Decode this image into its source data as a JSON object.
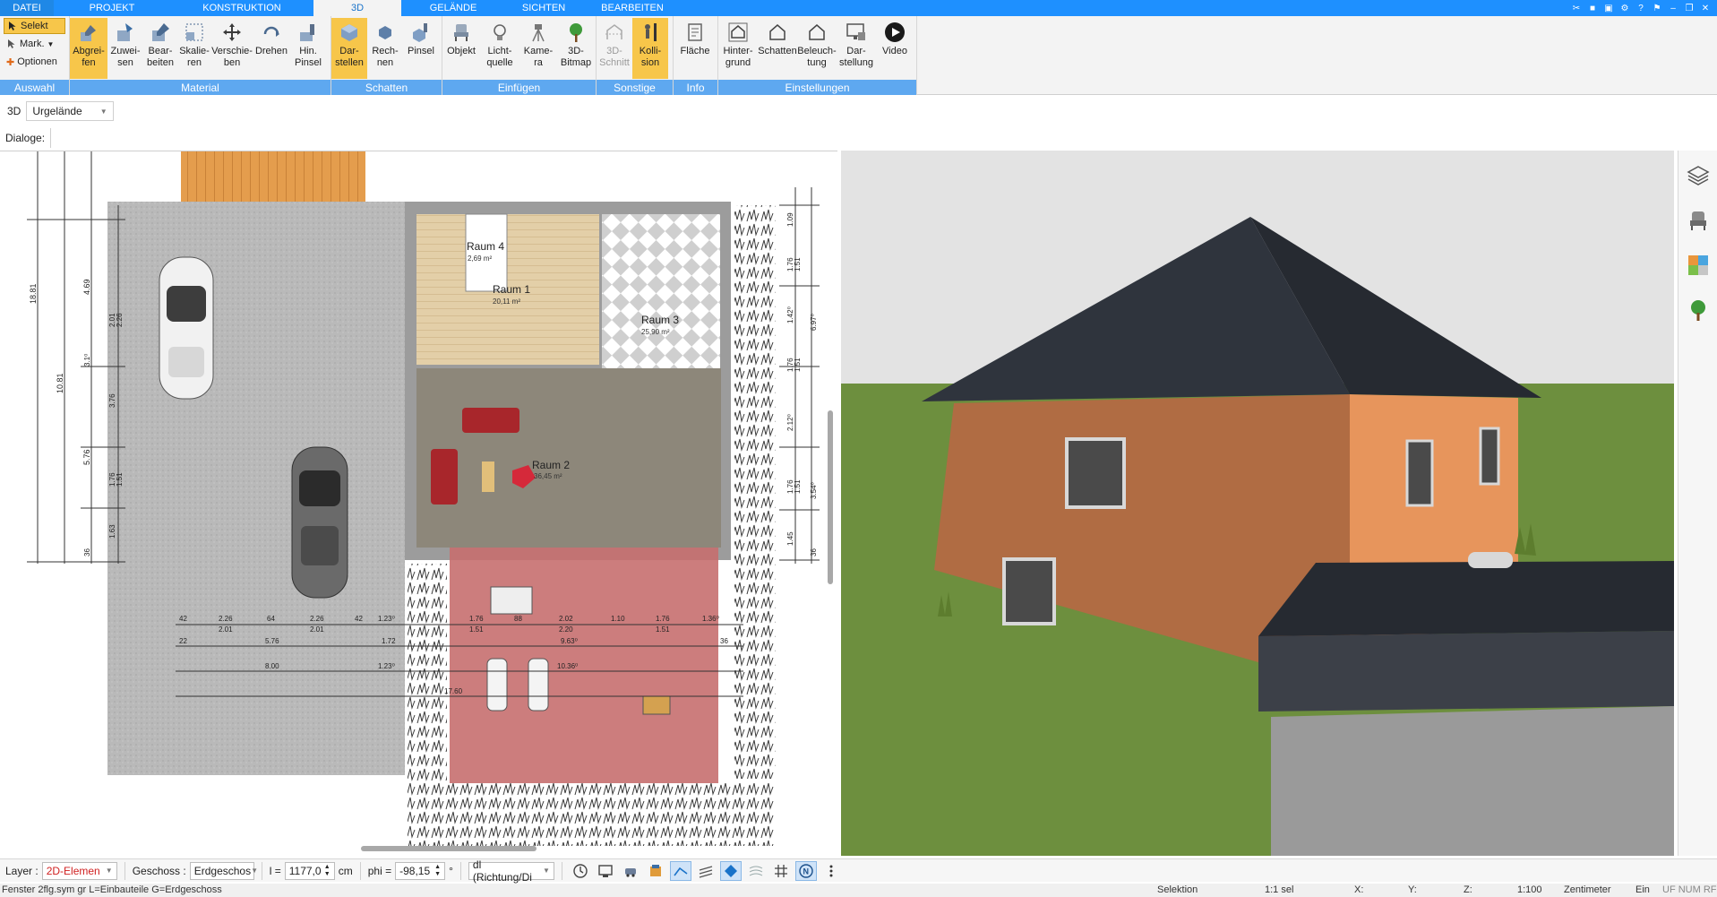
{
  "menu": {
    "tabs": [
      {
        "label": "DATEI"
      },
      {
        "label": "PROJEKT"
      },
      {
        "label": "KONSTRUKTION"
      },
      {
        "label": "3D"
      },
      {
        "label": "GELÄNDE"
      },
      {
        "label": "SICHTEN"
      },
      {
        "label": "BEARBEITEN"
      }
    ],
    "active_tab": "3D"
  },
  "ribbon": {
    "selection": {
      "items": [
        "Selekt",
        "Mark.",
        "Optionen"
      ],
      "group_label": "Auswahl"
    },
    "groups": [
      {
        "label": "Material",
        "buttons": [
          "Abgrei-\nfen",
          "Zuwei-\nsen",
          "Bear-\nbeiten",
          "Skalie-\nren",
          "Verschie-\nben",
          "Drehen",
          "Hin.\nPinsel"
        ]
      },
      {
        "label": "Schatten",
        "buttons": [
          "Dar-\nstellen",
          "Rech-\nnen",
          "Pinsel"
        ]
      },
      {
        "label": "Einfügen",
        "buttons": [
          "Objekt",
          "Licht-\nquelle",
          "Kame-\nra",
          "3D-\nBitmap"
        ]
      },
      {
        "label": "Sonstige",
        "buttons": [
          "3D-\nSchnitt",
          "Kolli-\nsion"
        ]
      },
      {
        "label": "Info",
        "buttons": [
          "Fläche"
        ]
      },
      {
        "label": "Einstellungen",
        "buttons": [
          "Hinter-\ngrund",
          "Schatten",
          "Beleuch-\ntung",
          "Dar-\nstellung",
          "Video"
        ]
      }
    ]
  },
  "view_toolbar": {
    "mode": "3D",
    "terrain": "Urgelände",
    "dialoge_label": "Dialoge:"
  },
  "plan": {
    "rooms": [
      {
        "name": "Raum 4",
        "area": "2,69 m²"
      },
      {
        "name": "Raum 1",
        "area": "20,11 m²"
      },
      {
        "name": "Raum 3",
        "area": "25,90 m²"
      },
      {
        "name": "Raum 2",
        "area": "36,45 m²"
      }
    ],
    "dims_left": [
      "18.81",
      "10.81",
      "4.69",
      "5.76",
      "2.01",
      "2.26",
      "3.1⁰",
      "3.76",
      "1.76",
      "1.51",
      "1.63",
      "36"
    ],
    "dims_right": [
      "1.09",
      "1.76",
      "1.51",
      "1.42⁰",
      "6.97⁰",
      "1.76",
      "1.51",
      "2.12⁰",
      "1.76",
      "1.51",
      "3.54⁰",
      "1.45",
      "36"
    ],
    "dims_bottom_row1": [
      "42",
      "2.26",
      "64",
      "2.26",
      "42",
      "1.23⁰",
      "1.76",
      "88",
      "2.02",
      "1.10",
      "1.76",
      "1.36⁰"
    ],
    "dims_bottom_row1b": [
      "2.01",
      "2.01",
      "1.51",
      "2.20",
      "1.51"
    ],
    "dims_bottom_row2": [
      "22",
      "5.76",
      "1.72",
      "9.63⁰",
      "36"
    ],
    "dims_bottom_row3": [
      "8.00",
      "1.23⁰",
      "10.36⁰"
    ],
    "dims_bottom_row4": [
      "17.60"
    ]
  },
  "bottom_toolbar": {
    "layer_label": "Layer :",
    "layer_value": "2D-Elemen",
    "geschoss_label": "Geschoss :",
    "geschoss_value": "Erdgeschos",
    "l_label": "l =",
    "l_value": "1177,0",
    "l_unit": "cm",
    "phi_label": "phi =",
    "phi_value": "-98,15",
    "phi_unit": "°",
    "direction_value": "dl (Richtung/Di"
  },
  "status": {
    "left": "Fenster 2flg.sym gr L=Einbauteile G=Erdgeschoss",
    "mode": "Selektion",
    "sel": "1:1 sel",
    "x": "X:",
    "y": "Y:",
    "z": "Z:",
    "scale": "1:100",
    "unit": "Zentimeter",
    "ein": "Ein",
    "flags": "UF NUM RF"
  },
  "colors": {
    "accent": "#1e90ff",
    "group_label": "#5ea8f0",
    "active_button": "#f7c64a",
    "roof": "#2f343d",
    "wall_left": "#b06c43",
    "wall_right": "#e7955c",
    "grass": "#6d8f3e"
  }
}
